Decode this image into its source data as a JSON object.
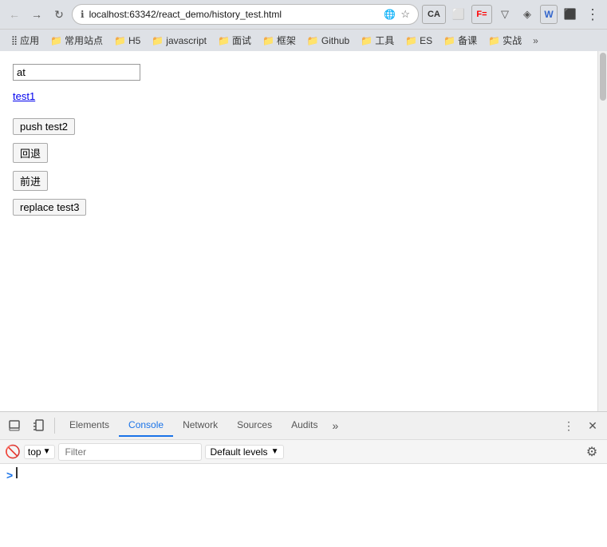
{
  "browser": {
    "back_btn": "←",
    "forward_btn": "→",
    "reload_btn": "↻",
    "address": "localhost:63342/react_demo/history_test.html",
    "address_icon": "🔒",
    "star_icon": "☆",
    "ext_icons": [
      "CA",
      "⬜",
      "F=",
      "▽",
      "◈",
      "W",
      "⬛"
    ],
    "menu_btn": "⋮"
  },
  "bookmarks": {
    "apps_label": "应用",
    "items": [
      {
        "label": "常用站点",
        "folder": true
      },
      {
        "label": "H5",
        "folder": true
      },
      {
        "label": "javascript",
        "folder": true
      },
      {
        "label": "面试",
        "folder": true
      },
      {
        "label": "框架",
        "folder": true
      },
      {
        "label": "Github",
        "folder": true
      },
      {
        "label": "工具",
        "folder": true
      },
      {
        "label": "ES",
        "folder": true
      },
      {
        "label": "备课",
        "folder": true
      },
      {
        "label": "实战",
        "folder": true
      }
    ],
    "more": "»"
  },
  "page": {
    "input_value": "at",
    "input_placeholder": "",
    "link_text": "test1",
    "buttons": [
      {
        "label": "push test2"
      },
      {
        "label": "回退"
      },
      {
        "label": "前进"
      },
      {
        "label": "replace test3"
      }
    ]
  },
  "devtools": {
    "inspect_icon": "⬚",
    "device_icon": "📱",
    "tabs": [
      {
        "label": "Elements",
        "active": false
      },
      {
        "label": "Console",
        "active": true
      },
      {
        "label": "Network",
        "active": false
      },
      {
        "label": "Sources",
        "active": false
      },
      {
        "label": "Audits",
        "active": false
      }
    ],
    "more_tabs": "»",
    "settings_icon": "⋮",
    "close_icon": "✕",
    "no_entry": "🚫",
    "context_label": "top",
    "dropdown_arrow": "▼",
    "filter_placeholder": "Filter",
    "levels_label": "Default levels",
    "levels_arrow": "▼",
    "gear_icon": "⚙",
    "console_prompt": ">"
  }
}
